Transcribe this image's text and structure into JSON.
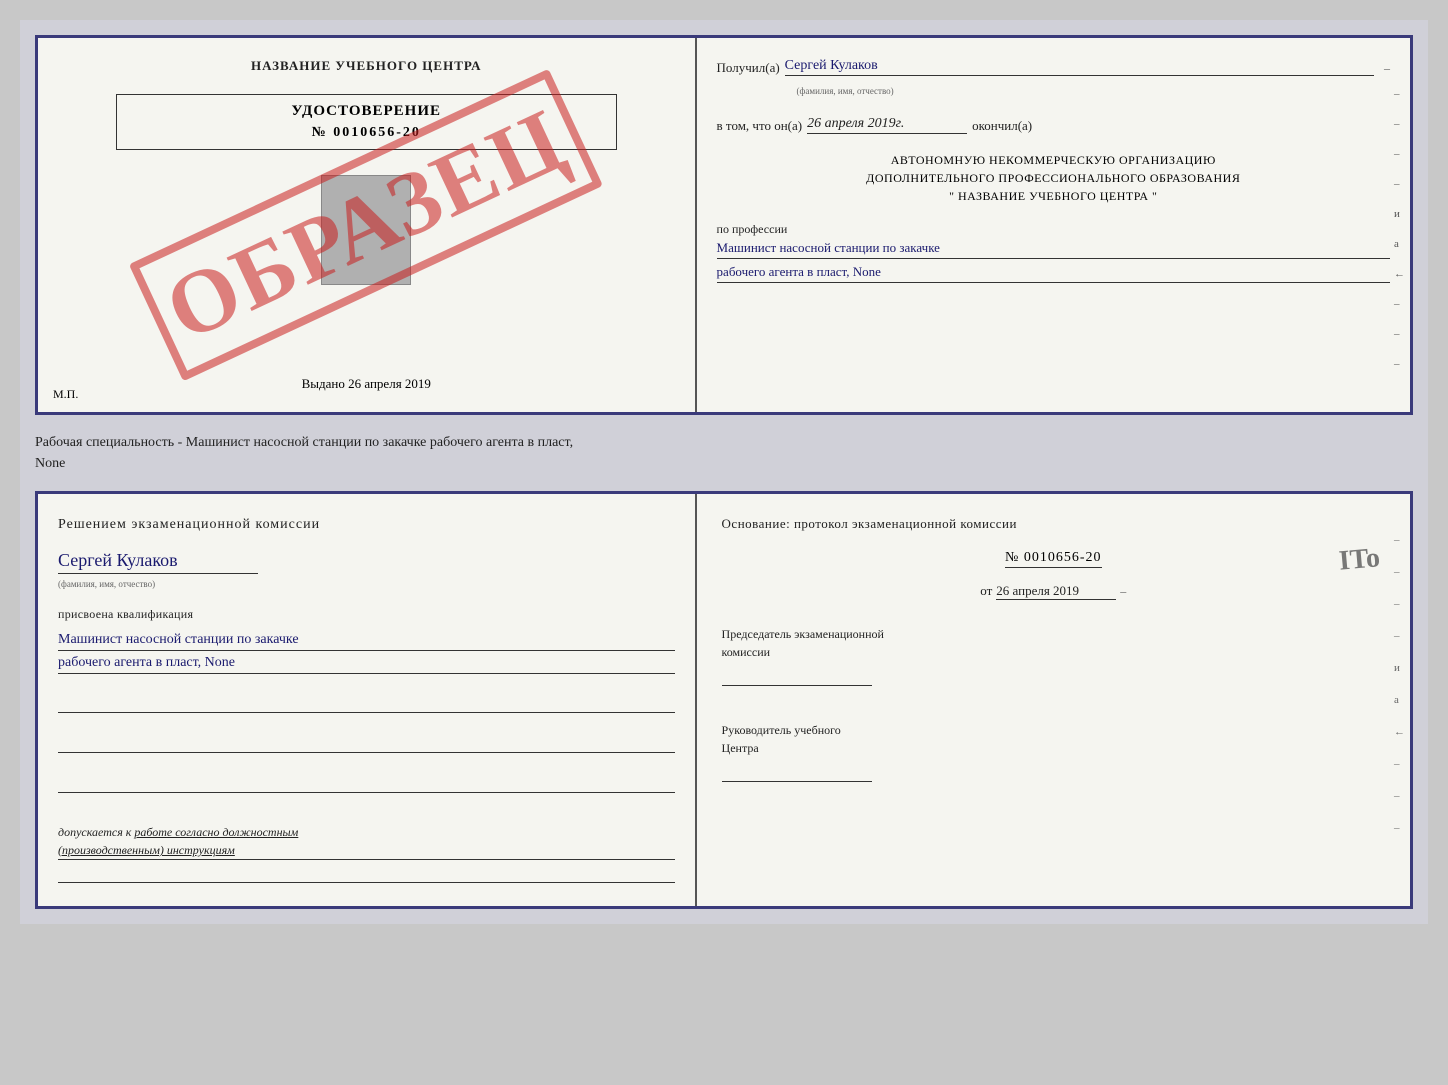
{
  "topDoc": {
    "left": {
      "centerTitle": "НАЗВАНИЕ УЧЕБНОГО ЦЕНТРА",
      "watermark": "ОБРАЗЕЦ",
      "certTitle": "УДОСТОВЕРЕНИЕ",
      "certNumber": "№ 0010656-20",
      "issuedLabel": "Выдано",
      "issuedDate": "26 апреля 2019",
      "mpLabel": "М.П."
    },
    "right": {
      "receivedLabel": "Получил(а)",
      "receivedName": "Сергей Кулаков",
      "nameHint": "(фамилия, имя, отчество)",
      "dateLabel": "в том, что он(а)",
      "dateValue": "26 апреля 2019г.",
      "dateEndLabel": "окончил(а)",
      "blockLine1": "АВТОНОМНУЮ НЕКОММЕРЧЕСКУЮ ОРГАНИЗАЦИЮ",
      "blockLine2": "ДОПОЛНИТЕЛЬНОГО ПРОФЕССИОНАЛЬНОГО ОБРАЗОВАНИЯ",
      "blockLine3": "\" НАЗВАНИЕ УЧЕБНОГО ЦЕНТРА \"",
      "professionLabel": "по профессии",
      "professionLine1": "Машинист насосной станции по закачке",
      "professionLine2": "рабочего агента в пласт, None",
      "sideChars": [
        "-",
        "-",
        "-",
        "-",
        "и",
        "а",
        "←",
        "-",
        "-",
        "-"
      ]
    }
  },
  "middleText": "Рабочая специальность - Машинист насосной станции по закачке рабочего агента в пласт,\nNone",
  "bottomDoc": {
    "left": {
      "decisionTitle": "Решением экзаменационной комиссии",
      "personName": "Сергей Кулаков",
      "nameHint": "(фамилия, имя, отчество)",
      "assignedLabel": "присвоена квалификация",
      "profLine1": "Машинист насосной станции по закачке",
      "profLine2": "рабочего агента в пласт, None",
      "admissionLabel": "допускается к",
      "admissionText": "работе согласно должностным\n(производственным) инструкциям"
    },
    "right": {
      "basisLabel": "Основание: протокол экзаменационной комиссии",
      "protocolNumber": "№ 0010656-20",
      "datePrefix": "от",
      "dateValue": "26 апреля 2019",
      "chairmanLabel": "Председатель экзаменационной\nкомиссии",
      "directorLabel": "Руководитель учебного\nЦентра",
      "itoStamp": "ITo",
      "sideChars": [
        "-",
        "-",
        "-",
        "-",
        "и",
        "а",
        "←",
        "-",
        "-",
        "-"
      ]
    }
  }
}
